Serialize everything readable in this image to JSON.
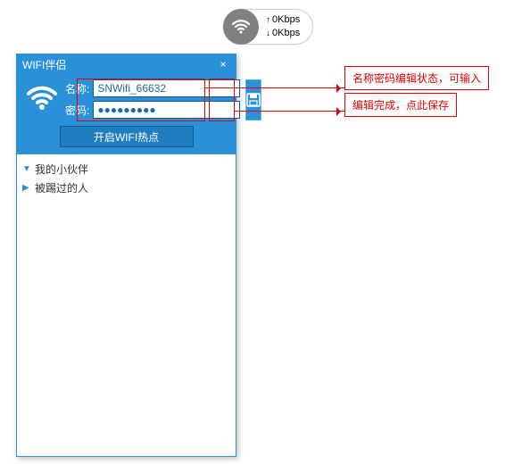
{
  "speed": {
    "up": "0Kbps",
    "down": "0Kbps"
  },
  "window": {
    "title": "WIFI伴侣",
    "close": "×",
    "name_label": "名称:",
    "name_value": "SNWifi_66632",
    "pwd_label": "密码:",
    "pwd_value": "●●●●●●●●●",
    "start_label": "开启WIFI热点"
  },
  "list": {
    "item1": "我的小伙伴",
    "item2": "被踢过的人"
  },
  "annotations": {
    "a1": "名称密码编辑状态，可输入",
    "a2": "编辑完成，点此保存"
  }
}
